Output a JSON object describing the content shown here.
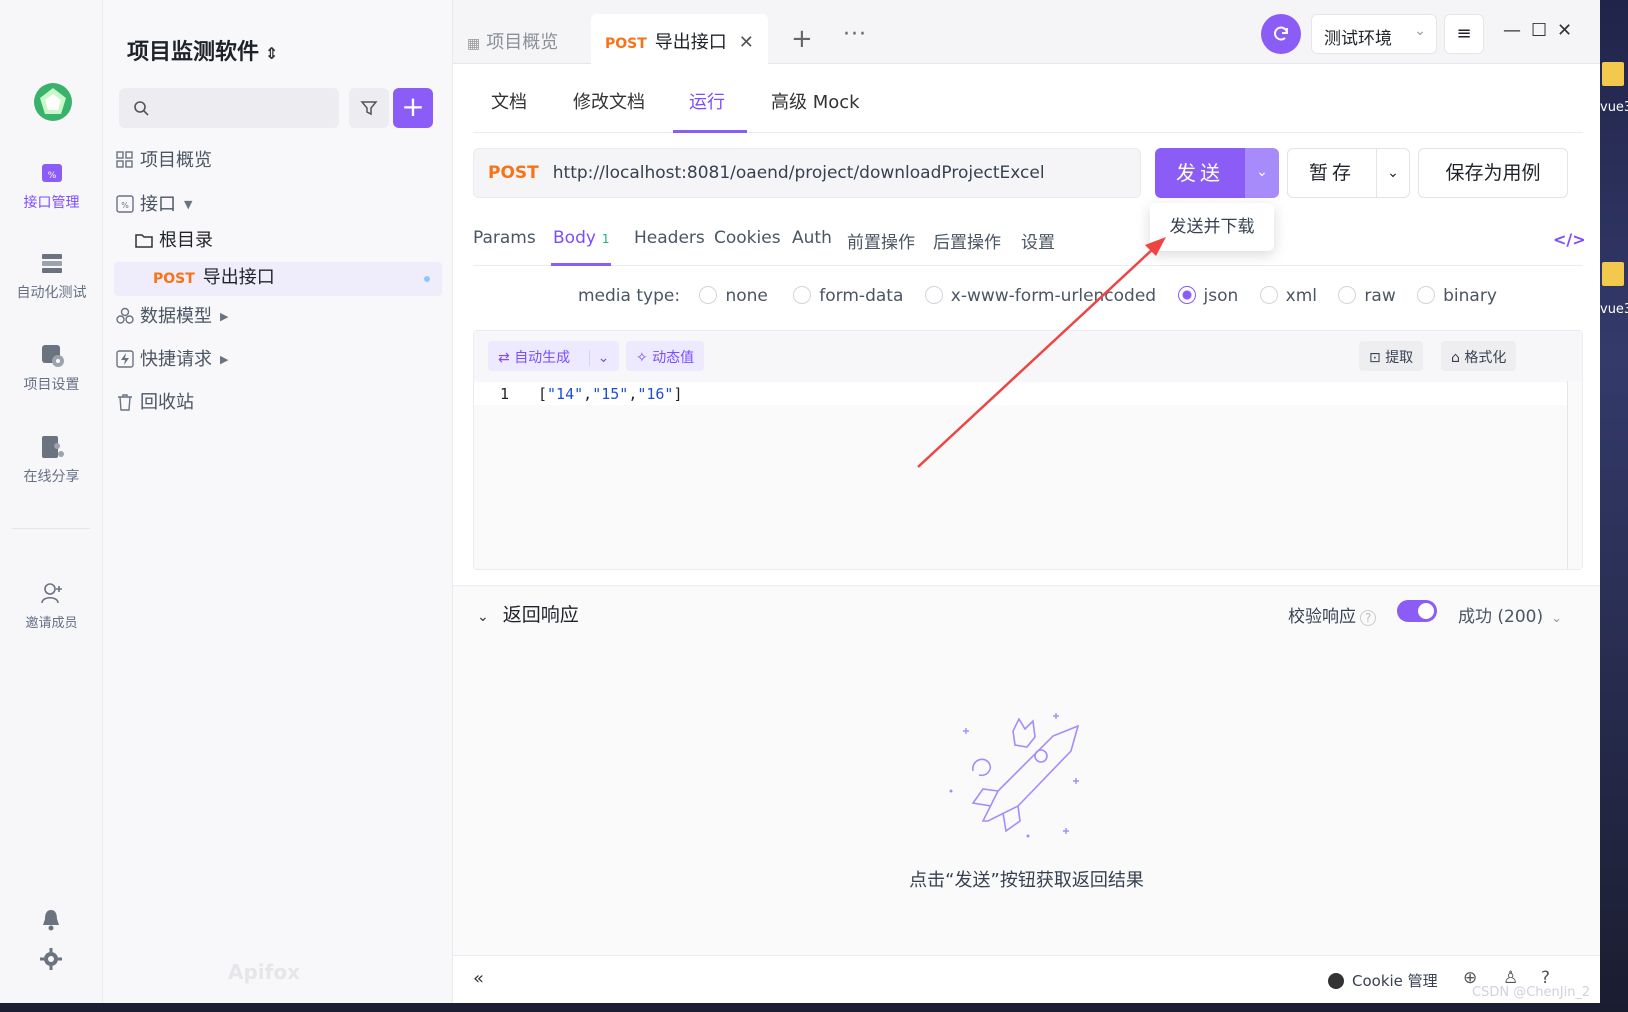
{
  "app": {
    "project_name": "项目监测软件",
    "watermark": "Apifox"
  },
  "rail": {
    "items": [
      {
        "label": "接口管理",
        "icon": "api-management-icon",
        "active": true
      },
      {
        "label": "自动化测试",
        "icon": "automation-test-icon",
        "active": false
      },
      {
        "label": "项目设置",
        "icon": "project-settings-icon",
        "active": false
      },
      {
        "label": "在线分享",
        "icon": "online-share-icon",
        "active": false
      }
    ],
    "invite_label": "邀请成员"
  },
  "tree": {
    "search_placeholder": "",
    "nodes": [
      {
        "label": "项目概览",
        "icon": "grid-icon"
      },
      {
        "label": "接口",
        "icon": "api-icon"
      },
      {
        "label": "根目录",
        "icon": "folder-icon"
      },
      {
        "method": "POST",
        "label": "导出接口",
        "selected": true
      },
      {
        "label": "数据模型",
        "icon": "data-model-icon"
      },
      {
        "label": "快捷请求",
        "icon": "quick-request-icon"
      },
      {
        "label": "回收站",
        "icon": "trash-icon"
      }
    ]
  },
  "tabs": [
    {
      "label": "项目概览",
      "active": false
    },
    {
      "method": "POST",
      "label": "导出接口",
      "active": true
    }
  ],
  "header": {
    "environment": "测试环境"
  },
  "subtabs": [
    "文档",
    "修改文档",
    "运行",
    "高级 Mock"
  ],
  "request": {
    "method": "POST",
    "url": "http://localhost:8081/oaend/project/downloadProjectExcel",
    "send_label": "发送",
    "save_label": "暂存",
    "save_case_label": "保存为用例",
    "dropdown_option": "发送并下载"
  },
  "body_tabs": [
    {
      "label": "Params"
    },
    {
      "label": "Body",
      "badge": "1",
      "active": true
    },
    {
      "label": "Headers"
    },
    {
      "label": "Cookies"
    },
    {
      "label": "Auth"
    },
    {
      "label": "前置操作"
    },
    {
      "label": "后置操作"
    },
    {
      "label": "设置"
    }
  ],
  "media_type": {
    "label": "media type:",
    "options": [
      "none",
      "form-data",
      "x-www-form-urlencoded",
      "json",
      "xml",
      "raw",
      "binary"
    ],
    "selected": "json"
  },
  "editor": {
    "auto_generate": "自动生成",
    "dynamic_value": "动态值",
    "extract": "提取",
    "format": "格式化",
    "line_number": "1",
    "code": [
      "[",
      "\"14\"",
      ",",
      "\"15\"",
      ",",
      "\"16\"",
      "]"
    ]
  },
  "response": {
    "title": "返回响应",
    "verify_label": "校验响应",
    "status": "成功 (200)",
    "empty_text": "点击“发送”按钮获取返回结果"
  },
  "footer": {
    "cookie_label": "Cookie 管理"
  },
  "desktop": {
    "icon_label": "vue3",
    "credit": "CSDN @ChenJin_2"
  },
  "colors": {
    "accent": "#8b5cf6",
    "post": "#f97316"
  }
}
